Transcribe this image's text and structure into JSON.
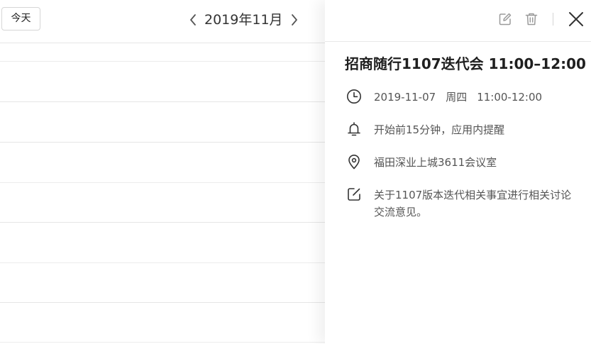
{
  "calendar": {
    "today_label": "今天",
    "month_label": "2019年11月"
  },
  "event": {
    "title": "招商随行1107迭代会 11:00–12:00",
    "date": "2019-11-07",
    "weekday": "周四",
    "time_range": "11:00-12:00",
    "reminder": "开始前15分钟，应用内提醒",
    "location": "福田深业上城3611会议室",
    "description": "关于1107版本迭代相关事宜进行相关讨论交流意见。"
  },
  "icons": {
    "prev": "chevron-left-icon",
    "next": "chevron-right-icon",
    "edit": "edit-icon",
    "delete": "trash-icon",
    "close": "close-icon",
    "time": "clock-icon",
    "reminder": "bell-icon",
    "location": "location-pin-icon",
    "description": "note-icon"
  },
  "colors": {
    "icon_gray": "#9a9a9a",
    "icon_dark": "#333333",
    "text_secondary": "#555555",
    "divider": "#e6e6e6"
  }
}
